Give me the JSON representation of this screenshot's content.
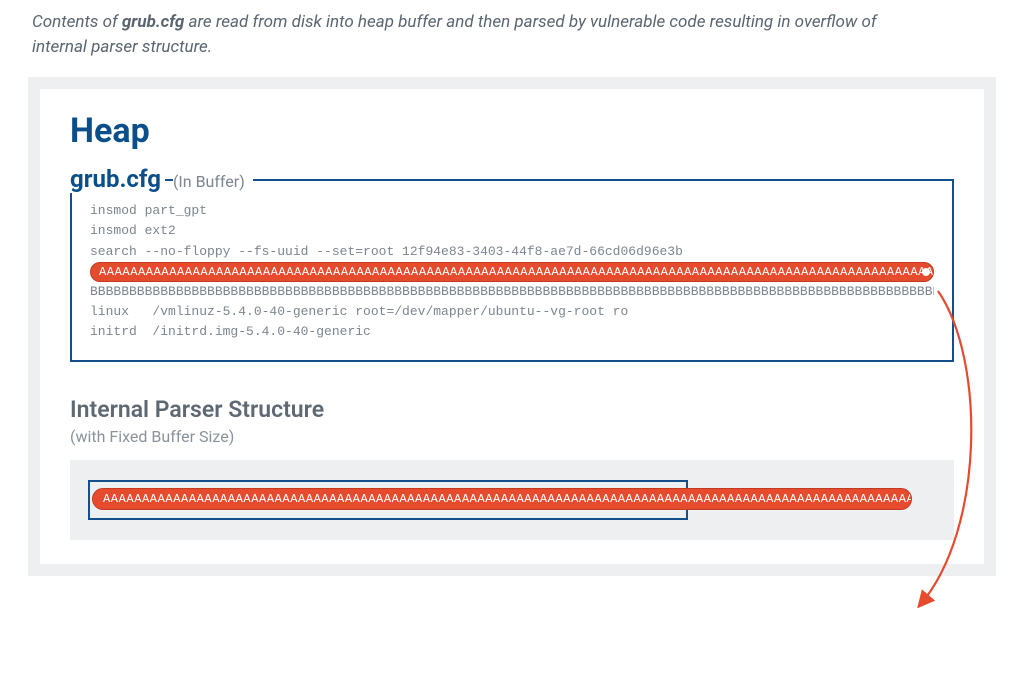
{
  "caption_prefix": "Contents of ",
  "caption_bold": "grub.cfg",
  "caption_suffix": " are read from disk into heap buffer and then parsed by vulnerable code resulting in overflow of internal parser structure.",
  "heap_title": "Heap",
  "grub_name": "grub.cfg",
  "grub_sub": "(In Buffer)",
  "code_lines": {
    "l1": "insmod part_gpt",
    "l2": "insmod ext2",
    "l3": "search --no-floppy --fs-uuid --set=root 12f94e83-3403-44f8-ae7d-66cd06d96e3b",
    "la": "AAAAAAAAAAAAAAAAAAAAAAAAAAAAAAAAAAAAAAAAAAAAAAAAAAAAAAAAAAAAAAAAAAAAAAAAAAAAAAAAAAAAAAAAAAAAAAAAAAAAAAAAAAAAAAAAAAAAAAAAAAAAAAAAAAAAAAAAAAAAAAAAAAAAAA",
    "lb": "BBBBBBBBBBBBBBBBBBBBBBBBBBBBBBBBBBBBBBBBBBBBBBBBBBBBBBBBBBBBBBBBBBBBBBBBBBBBBBBBBBBBBBBBBBBBBBBBBBBBBBBBBBBBBBBBBBBBBBBBBBBBBBBBBBBBBBBBBBBBBBBBBBBBBB",
    "l4": "linux   /vmlinuz-5.4.0-40-generic root=/dev/mapper/ubuntu--vg-root ro",
    "l5": "initrd  /initrd.img-5.4.0-40-generic"
  },
  "overflow_text": "AAAAAAAAAAAAAAAAAAAAAAAAAAAAAAAAAAAAAAAAAAAAAAAAAAAAAAAAAAAAAAAAAAAAAAAAAAAAAAAAAAAAAAAAAAAAAAAAAAAAAAAAAAAAAAAAAAAAAAAAAAAAAAAAAAAAAAAAAAAAAAAAAAAAAAAAAAAAAAAAAAAAAAAAAA",
  "parser_title": "Internal Parser Structure",
  "parser_sub": "(with Fixed Buffer Size)"
}
